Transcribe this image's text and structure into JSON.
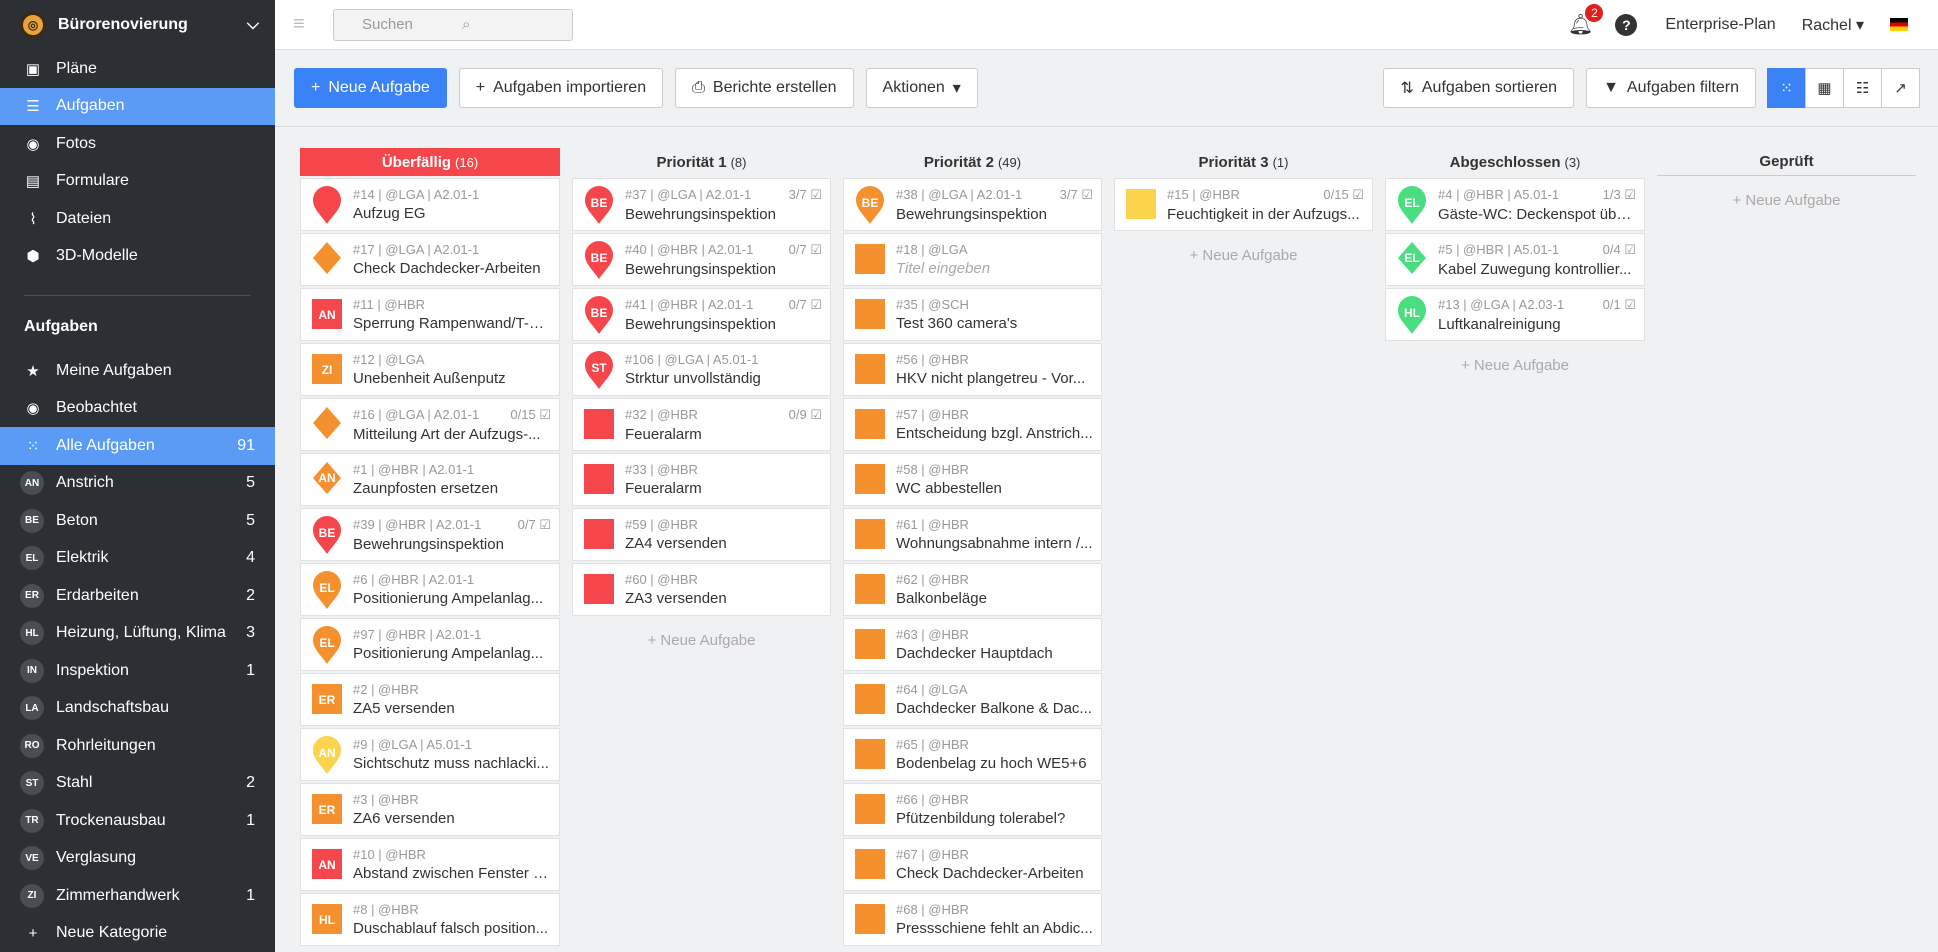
{
  "sidebar": {
    "project": "Bürorenovierung",
    "nav": [
      {
        "label": "Pläne",
        "icon": "plans-icon",
        "glyph": "▣"
      },
      {
        "label": "Aufgaben",
        "icon": "list-icon",
        "glyph": "☰"
      },
      {
        "label": "Fotos",
        "icon": "camera-icon",
        "glyph": "◉"
      },
      {
        "label": "Formulare",
        "icon": "clipboard-icon",
        "glyph": "▤"
      },
      {
        "label": "Dateien",
        "icon": "paperclip-icon",
        "glyph": "⌇"
      },
      {
        "label": "3D-Modelle",
        "icon": "cube-icon",
        "glyph": "⬢"
      }
    ],
    "section_title": "Aufgaben",
    "task_nav": [
      {
        "label": "Meine Aufgaben",
        "icon": "star-icon",
        "glyph": "★",
        "count": ""
      },
      {
        "label": "Beobachtet",
        "icon": "eye-icon",
        "glyph": "◉",
        "count": ""
      },
      {
        "label": "Alle Aufgaben",
        "icon": "grid-icon",
        "glyph": "⁙",
        "count": "91"
      }
    ],
    "categories": [
      {
        "abbr": "AN",
        "label": "Anstrich",
        "count": "5"
      },
      {
        "abbr": "BE",
        "label": "Beton",
        "count": "5"
      },
      {
        "abbr": "EL",
        "label": "Elektrik",
        "count": "4"
      },
      {
        "abbr": "ER",
        "label": "Erdarbeiten",
        "count": "2"
      },
      {
        "abbr": "HL",
        "label": "Heizung, Lüftung, Klima",
        "count": "3"
      },
      {
        "abbr": "IN",
        "label": "Inspektion",
        "count": "1"
      },
      {
        "abbr": "LA",
        "label": "Landschaftsbau",
        "count": ""
      },
      {
        "abbr": "RO",
        "label": "Rohrleitungen",
        "count": ""
      },
      {
        "abbr": "ST",
        "label": "Stahl",
        "count": "2"
      },
      {
        "abbr": "TR",
        "label": "Trockenausbau",
        "count": "1"
      },
      {
        "abbr": "VE",
        "label": "Verglasung",
        "count": ""
      },
      {
        "abbr": "ZI",
        "label": "Zimmerhandwerk",
        "count": "1"
      }
    ],
    "new_category": "Neue Kategorie"
  },
  "topbar": {
    "search_placeholder": "Suchen",
    "notifications": "2",
    "help": "?",
    "plan": "Enterprise-Plan",
    "user": "Rachel"
  },
  "toolbar": {
    "new_task": "Neue Aufgabe",
    "import": "Aufgaben importieren",
    "reports": "Berichte erstellen",
    "actions": "Aktionen",
    "sort": "Aufgaben sortieren",
    "filter": "Aufgaben filtern"
  },
  "colors": {
    "red": "#f5474b",
    "orange": "#f5902f",
    "yellow": "#fcd34d",
    "green": "#4ade80",
    "accent": "#3b82f6"
  },
  "board": {
    "add_label": "+ Neue Aufgabe",
    "columns": [
      {
        "title": "Überfällig",
        "count": "(16)",
        "style": "red",
        "cards": [
          {
            "meta": "#14 | @LGA | A2.01-1",
            "title": "Aufzug EG",
            "shape": "pin",
            "color": "red",
            "abbr": "",
            "prog": ""
          },
          {
            "meta": "#17 | @LGA | A2.01-1",
            "title": "Check Dachdecker-Arbeiten",
            "shape": "diamond",
            "color": "orange",
            "abbr": "",
            "prog": ""
          },
          {
            "meta": "#11 | @HBR",
            "title": "Sperrung Rampenwand/T-S...",
            "shape": "square",
            "color": "red",
            "abbr": "AN",
            "prog": ""
          },
          {
            "meta": "#12 | @LGA",
            "title": "Unebenheit Außenputz",
            "shape": "square",
            "color": "orange",
            "abbr": "ZI",
            "prog": ""
          },
          {
            "meta": "#16 | @LGA | A2.01-1",
            "title": "Mitteilung Art der Aufzugs-...",
            "shape": "diamond",
            "color": "orange",
            "abbr": "",
            "prog": "0/15"
          },
          {
            "meta": "#1 | @HBR | A2.01-1",
            "title": "Zaunpfosten ersetzen",
            "shape": "diamond",
            "color": "orange",
            "abbr": "AN",
            "prog": ""
          },
          {
            "meta": "#39 | @HBR | A2.01-1",
            "title": "Bewehrungsinspektion",
            "shape": "pin",
            "color": "red",
            "abbr": "BE",
            "prog": "0/7"
          },
          {
            "meta": "#6 | @HBR | A2.01-1",
            "title": "Positionierung Ampelanlag...",
            "shape": "pin",
            "color": "orange",
            "abbr": "EL",
            "prog": ""
          },
          {
            "meta": "#97 | @HBR | A2.01-1",
            "title": "Positionierung Ampelanlag...",
            "shape": "pin",
            "color": "orange",
            "abbr": "EL",
            "prog": ""
          },
          {
            "meta": "#2 | @HBR",
            "title": "ZA5 versenden",
            "shape": "square",
            "color": "orange",
            "abbr": "ER",
            "prog": ""
          },
          {
            "meta": "#9 | @LGA | A5.01-1",
            "title": "Sichtschutz muss nachlacki...",
            "shape": "pin",
            "color": "yellow",
            "abbr": "AN",
            "prog": ""
          },
          {
            "meta": "#3 | @HBR",
            "title": "ZA6 versenden",
            "shape": "square",
            "color": "orange",
            "abbr": "ER",
            "prog": ""
          },
          {
            "meta": "#10 | @HBR",
            "title": "Abstand zwischen Fenster u...",
            "shape": "square",
            "color": "red",
            "abbr": "AN",
            "prog": ""
          },
          {
            "meta": "#8 | @HBR",
            "title": "Duschablauf falsch position...",
            "shape": "square",
            "color": "orange",
            "abbr": "HL",
            "prog": ""
          }
        ],
        "add": false
      },
      {
        "title": "Priorität 1",
        "count": "(8)",
        "style": "plain",
        "cards": [
          {
            "meta": "#37 | @LGA | A2.01-1",
            "title": "Bewehrungsinspektion",
            "shape": "pin",
            "color": "red",
            "abbr": "BE",
            "prog": "3/7"
          },
          {
            "meta": "#40 | @HBR | A2.01-1",
            "title": "Bewehrungsinspektion",
            "shape": "pin",
            "color": "red",
            "abbr": "BE",
            "prog": "0/7"
          },
          {
            "meta": "#41 | @HBR | A2.01-1",
            "title": "Bewehrungsinspektion",
            "shape": "pin",
            "color": "red",
            "abbr": "BE",
            "prog": "0/7"
          },
          {
            "meta": "#106 | @LGA | A5.01-1",
            "title": "Strktur unvollständig",
            "shape": "pin",
            "color": "red",
            "abbr": "ST",
            "prog": ""
          },
          {
            "meta": "#32 | @HBR",
            "title": "Feueralarm",
            "shape": "square",
            "color": "red",
            "abbr": "",
            "prog": "0/9"
          },
          {
            "meta": "#33 | @HBR",
            "title": "Feueralarm",
            "shape": "square",
            "color": "red",
            "abbr": "",
            "prog": ""
          },
          {
            "meta": "#59 | @HBR",
            "title": "ZA4 versenden",
            "shape": "square",
            "color": "red",
            "abbr": "",
            "prog": ""
          },
          {
            "meta": "#60 | @HBR",
            "title": "ZA3 versenden",
            "shape": "square",
            "color": "red",
            "abbr": "",
            "prog": ""
          }
        ],
        "add": true
      },
      {
        "title": "Priorität 2",
        "count": "(49)",
        "style": "plain",
        "cards": [
          {
            "meta": "#38 | @LGA | A2.01-1",
            "title": "Bewehrungsinspektion",
            "shape": "pin",
            "color": "orange",
            "abbr": "BE",
            "prog": "3/7"
          },
          {
            "meta": "#18 | @LGA",
            "title": "Titel eingeben",
            "shape": "square",
            "color": "orange",
            "abbr": "",
            "prog": "",
            "ph": true
          },
          {
            "meta": "#35 | @SCH",
            "title": "Test 360 camera's",
            "shape": "square",
            "color": "orange",
            "abbr": "",
            "prog": ""
          },
          {
            "meta": "#56 | @HBR",
            "title": "HKV nicht plangetreu - Vor...",
            "shape": "square",
            "color": "orange",
            "abbr": "",
            "prog": ""
          },
          {
            "meta": "#57 | @HBR",
            "title": "Entscheidung bzgl. Anstrich...",
            "shape": "square",
            "color": "orange",
            "abbr": "",
            "prog": ""
          },
          {
            "meta": "#58 | @HBR",
            "title": "WC abbestellen",
            "shape": "square",
            "color": "orange",
            "abbr": "",
            "prog": ""
          },
          {
            "meta": "#61 | @HBR",
            "title": "Wohnungsabnahme intern /...",
            "shape": "square",
            "color": "orange",
            "abbr": "",
            "prog": ""
          },
          {
            "meta": "#62 | @HBR",
            "title": "Balkonbeläge",
            "shape": "square",
            "color": "orange",
            "abbr": "",
            "prog": ""
          },
          {
            "meta": "#63 | @HBR",
            "title": "Dachdecker Hauptdach",
            "shape": "square",
            "color": "orange",
            "abbr": "",
            "prog": ""
          },
          {
            "meta": "#64 | @LGA",
            "title": "Dachdecker Balkone & Dac...",
            "shape": "square",
            "color": "orange",
            "abbr": "",
            "prog": ""
          },
          {
            "meta": "#65 | @HBR",
            "title": "Bodenbelag zu hoch WE5+6",
            "shape": "square",
            "color": "orange",
            "abbr": "",
            "prog": ""
          },
          {
            "meta": "#66 | @HBR",
            "title": "Pfützenbildung tolerabel?",
            "shape": "square",
            "color": "orange",
            "abbr": "",
            "prog": ""
          },
          {
            "meta": "#67 | @HBR",
            "title": "Check Dachdecker-Arbeiten",
            "shape": "square",
            "color": "orange",
            "abbr": "",
            "prog": ""
          },
          {
            "meta": "#68 | @HBR",
            "title": "Pressschiene fehlt an Abdic...",
            "shape": "square",
            "color": "orange",
            "abbr": "",
            "prog": ""
          }
        ],
        "add": false
      },
      {
        "title": "Priorität 3",
        "count": "(1)",
        "style": "plain",
        "cards": [
          {
            "meta": "#15 | @HBR",
            "title": "Feuchtigkeit in der Aufzugs...",
            "shape": "square",
            "color": "yellow",
            "abbr": "",
            "prog": "0/15"
          }
        ],
        "add": true
      },
      {
        "title": "Abgeschlossen",
        "count": "(3)",
        "style": "plain",
        "cards": [
          {
            "meta": "#4 | @HBR | A5.01-1",
            "title": "Gäste-WC: Deckenspot übe...",
            "shape": "pin",
            "color": "green",
            "abbr": "EL",
            "prog": "1/3"
          },
          {
            "meta": "#5 | @HBR | A5.01-1",
            "title": "Kabel Zuwegung kontrollier...",
            "shape": "diamond",
            "color": "green",
            "abbr": "EL",
            "prog": "0/4"
          },
          {
            "meta": "#13 | @LGA | A2.03-1",
            "title": "Luftkanalreinigung",
            "shape": "pin",
            "color": "green",
            "abbr": "HL",
            "prog": "0/1"
          }
        ],
        "add": true
      },
      {
        "title": "Geprüft",
        "count": "",
        "style": "line",
        "cards": [],
        "add": true
      }
    ]
  }
}
